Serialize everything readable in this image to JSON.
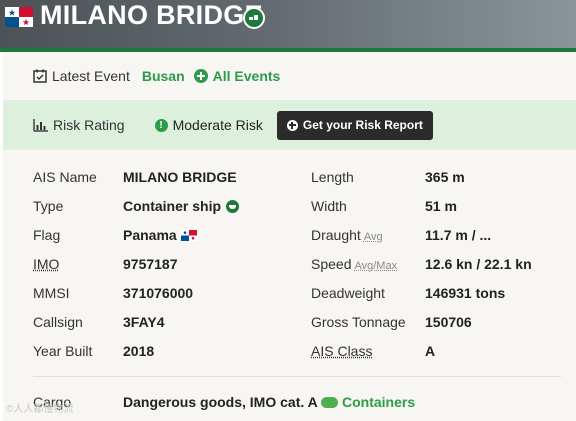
{
  "header": {
    "title": "MILANO BRIDGE",
    "flag_icon": "panama-flag-icon",
    "badge_icon": "ship-type-icon",
    "accent": "#1e7a3a"
  },
  "event": {
    "label": "Latest Event",
    "port": "Busan",
    "all_events": "All Events"
  },
  "risk": {
    "label": "Risk Rating",
    "level": "Moderate Risk",
    "button": "Get your Risk Report",
    "background": "#dcf0dd"
  },
  "left": {
    "ais_name": {
      "k": "AIS Name",
      "v": "MILANO BRIDGE"
    },
    "type": {
      "k": "Type",
      "v": "Container ship"
    },
    "flag": {
      "k": "Flag",
      "v": "Panama"
    },
    "imo": {
      "k": "IMO",
      "v": "9757187"
    },
    "mmsi": {
      "k": "MMSI",
      "v": "371076000"
    },
    "callsign": {
      "k": "Callsign",
      "v": "3FAY4"
    },
    "year": {
      "k": "Year Built",
      "v": "2018"
    }
  },
  "right": {
    "length": {
      "k": "Length",
      "v": "365 m"
    },
    "width": {
      "k": "Width",
      "v": "51 m"
    },
    "draught": {
      "k": "Draught",
      "sub": "Avg",
      "v": "11.7 m / ..."
    },
    "speed": {
      "k": "Speed",
      "sub": "Avg/Max",
      "v": "12.6 kn / 22.1 kn"
    },
    "deadweight": {
      "k": "Deadweight",
      "v": "146931 tons"
    },
    "gross": {
      "k": "Gross Tonnage",
      "v": "150706"
    },
    "ais_class": {
      "k": "AIS Class",
      "v": "A"
    }
  },
  "cargo": {
    "k": "Cargo",
    "v": "Dangerous goods, IMO cat. A",
    "tag": "Containers"
  },
  "watermark": "©人人都懂物流"
}
